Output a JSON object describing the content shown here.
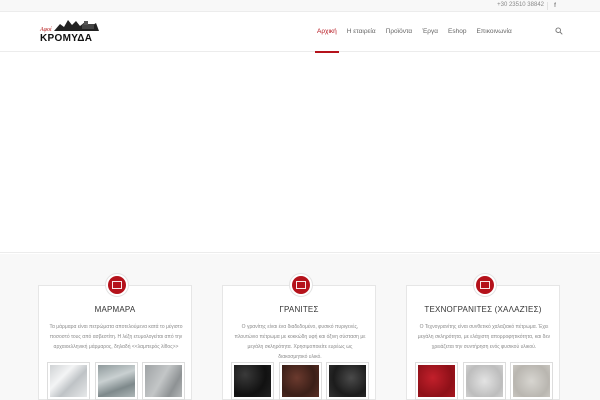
{
  "topbar": {
    "phone": "+30 23510 38842",
    "facebook_icon": "f"
  },
  "logo": {
    "script": "Αφοί",
    "word": "ΚΡΟΜΥΔΑ"
  },
  "nav": {
    "items": [
      {
        "label": "Αρχική",
        "active": true
      },
      {
        "label": "Η εταιρεία",
        "active": false
      },
      {
        "label": "Προϊόντα",
        "active": false
      },
      {
        "label": "Έργα",
        "active": false
      },
      {
        "label": "Eshop",
        "active": false
      },
      {
        "label": "Επικοινωνία",
        "active": false
      }
    ],
    "search_icon": "search-icon"
  },
  "colors": {
    "accent": "#b5121b",
    "nav_text": "#666666",
    "body_text": "#8a8a8a"
  },
  "cards": [
    {
      "title": "ΜΑΡΜΑΡΑ",
      "desc": "Τα μάρμαρα είναι πετρώματα αποτελούμενα κατά το μέγιστο ποσοστό τους από ασβεστίτη. Η λέξη ετυμολογείται από την αρχαιοελληνική μάρμαρος, δηλαδή <<λαμπερός λίθος>>",
      "icon": "tile-icon"
    },
    {
      "title": "ΓΡΑΝΙΤΕΣ",
      "desc": "Ο γρανίτης είναι ένα διαδεδομένο, φυσικό πυριγενές, πλουτώνιο πέτρωμα με κοκκώδη υφή και όξινη σύσταση με μεγάλη σκληρότητα. Χρησιμοποιείτε ευρέως ως διακοσμητικό υλικό.",
      "icon": "tile-icon"
    },
    {
      "title": "ΤΕΧΝΟΓΡΑΝΙΤΕΣ (ΧΑΛΑΖΊΕΣ)",
      "desc": "Ο Τεχνογρανίτης είναι συνθετικό χαλαζιακό πέτρωμα. Έχει μεγάλη σκληρότητα, με ελάχιστη απορροφητικότητα, και δεν χρειάζεται την συντήρηση ενός φυσικού υλικού.",
      "icon": "tile-icon"
    }
  ]
}
